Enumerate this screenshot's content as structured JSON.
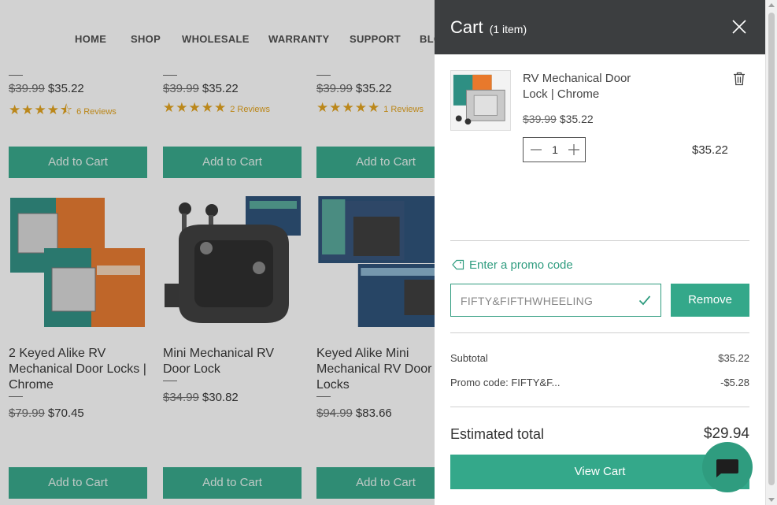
{
  "nav": {
    "items": [
      "HOME",
      "SHOP",
      "WHOLESALE",
      "WARRANTY",
      "SUPPORT",
      "BLOG"
    ]
  },
  "products_top": [
    {
      "old_price": "$39.99",
      "price": "$35.22",
      "stars": "★★★★⯪",
      "reviews": "6 Reviews",
      "button": "Add to Cart"
    },
    {
      "old_price": "$39.99",
      "price": "$35.22",
      "stars": "★★★★★",
      "reviews": "2 Reviews",
      "button": "Add to Cart"
    },
    {
      "old_price": "$39.99",
      "price": "$35.22",
      "stars": "★★★★★",
      "reviews": "1 Reviews",
      "button": "Add to Cart"
    }
  ],
  "products_bottom": [
    {
      "name": "2 Keyed Alike RV Mechanical Door Locks | Chrome",
      "old_price": "$79.99",
      "price": "$70.45",
      "button": "Add to Cart"
    },
    {
      "name": "Mini Mechanical RV Door Lock",
      "old_price": "$34.99",
      "price": "$30.82",
      "button": "Add to Cart"
    },
    {
      "name": "Keyed Alike Mini Mechanical RV Door Locks",
      "old_price": "$94.99",
      "price": "$83.66",
      "button": "Add to Cart"
    }
  ],
  "cart": {
    "title": "Cart",
    "count": "(1 item)",
    "item": {
      "name": "RV Mechanical Door Lock | Chrome",
      "old_price": "$39.99",
      "price": "$35.22",
      "quantity": "1",
      "line_total": "$35.22"
    },
    "promo_link": "Enter a promo code",
    "promo_value": "FIFTY&FIFTHWHEELING",
    "remove_label": "Remove",
    "subtotal_label": "Subtotal",
    "subtotal_value": "$35.22",
    "promo_label": "Promo code: FIFTY&F...",
    "promo_discount": "-$5.28",
    "estimated_label": "Estimated total",
    "estimated_value": "$29.94",
    "view_cart_label": "View Cart"
  },
  "colors": {
    "accent": "#34a88a",
    "header_bg": "#3c3e40",
    "star": "#e3a21a"
  },
  "icons": [
    "close-icon",
    "trash-icon",
    "minus-icon",
    "plus-icon",
    "tag-icon",
    "check-icon",
    "chat-icon"
  ]
}
